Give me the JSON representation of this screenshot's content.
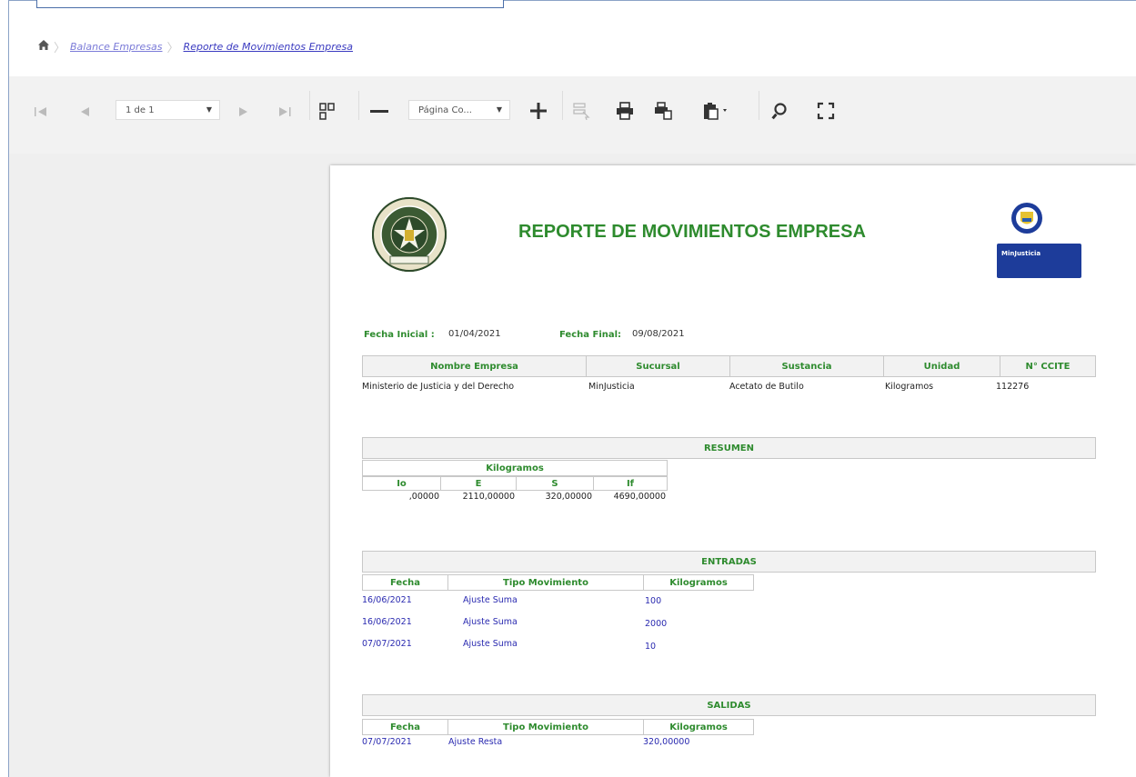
{
  "breadcrumb": {
    "home_icon": "home-icon",
    "items": [
      "Balance Empresas",
      "Reporte de Movimientos Empresa"
    ]
  },
  "toolbar": {
    "page_select": "1 de 1",
    "zoom_select": "Página Co..."
  },
  "report": {
    "title": "REPORTE DE MOVIMIENTOS EMPRESA",
    "fecha_inicial_label": "Fecha Inicial :",
    "fecha_inicial": "01/04/2021",
    "fecha_final_label": "Fecha Final:",
    "fecha_final": "09/08/2021",
    "company_headers": [
      "Nombre Empresa",
      "Sucursal",
      "Sustancia",
      "Unidad",
      "N° CCITE"
    ],
    "company_row": [
      "Ministerio de Justicia y del Derecho",
      "MinJusticia",
      "Acetato de Butilo",
      "Kilogramos",
      "112276"
    ],
    "resumen_title": "RESUMEN",
    "resumen_unit": "Kilogramos",
    "resumen_headers": [
      "Io",
      "E",
      "S",
      "If"
    ],
    "resumen_values": [
      ",00000",
      "2110,00000",
      "320,00000",
      "4690,00000"
    ],
    "entradas_title": "ENTRADAS",
    "mov_headers": [
      "Fecha",
      "Tipo Movimiento",
      "Kilogramos"
    ],
    "entradas": [
      [
        "16/06/2021",
        "Ajuste Suma",
        "100"
      ],
      [
        "16/06/2021",
        "Ajuste Suma",
        "2000"
      ],
      [
        "07/07/2021",
        "Ajuste Suma",
        "10"
      ]
    ],
    "salidas_title": "SALIDAS",
    "salidas": [
      [
        "07/07/2021",
        "Ajuste Resta",
        "320,00000"
      ]
    ],
    "minjusticia_logo_text": "MinJusticia"
  },
  "colors": {
    "title_green": "#2e8b2e",
    "link_blue": "#2a2ab0",
    "minjusticia_blue": "#1d3c9a"
  }
}
